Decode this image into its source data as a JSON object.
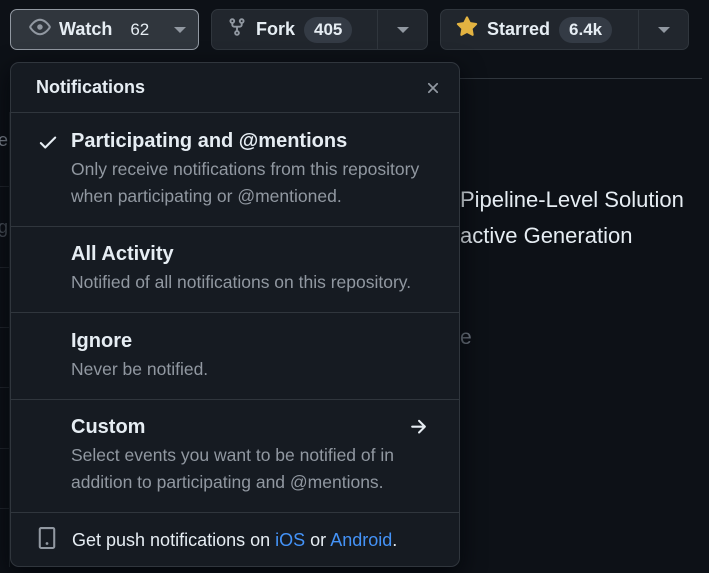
{
  "actions": {
    "watch": {
      "label": "Watch",
      "count": "62"
    },
    "fork": {
      "label": "Fork",
      "count": "405"
    },
    "star": {
      "label": "Starred",
      "count": "6.4k"
    }
  },
  "background": {
    "line1": "Pipeline-Level Solution",
    "line2": "active Generation",
    "faded": "e",
    "left_frag1": "e",
    "left_frag2": "g"
  },
  "dropdown": {
    "title": "Notifications",
    "items": [
      {
        "title": "Participating and @mentions",
        "desc_line1": "Only receive notifications from this repository",
        "desc_line2": "when participating or @mentioned.",
        "selected": true
      },
      {
        "title": "All Activity",
        "desc_line1": "Notified of all notifications on this repository.",
        "selected": false
      },
      {
        "title": "Ignore",
        "desc_line1": "Never be notified.",
        "selected": false
      },
      {
        "title": "Custom",
        "desc_line1": "Select events you want to be notified of in",
        "desc_line2": "addition to participating and @mentions.",
        "selected": false
      }
    ],
    "footer": {
      "prefix": "Get push notifications on",
      "ios": "iOS",
      "or": "or",
      "android": "Android",
      "suffix": "."
    }
  },
  "colors": {
    "background": "#0d1117",
    "surface": "#161b22",
    "border": "#30363d",
    "text_primary": "#e6edf3",
    "text_muted": "#9198a1",
    "link": "#4493f8",
    "star": "#e3b341"
  },
  "icons": [
    "eye-icon",
    "repo-forked-icon",
    "star-fill-icon",
    "triangle-down-icon",
    "x-icon",
    "check-icon",
    "arrow-right-icon",
    "device-mobile-icon"
  ]
}
